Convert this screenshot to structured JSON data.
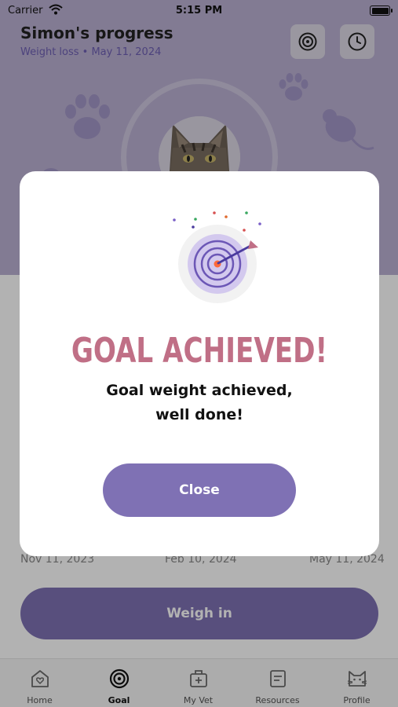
{
  "status": {
    "carrier": "Carrier",
    "time": "5:15 PM"
  },
  "header": {
    "title": "Simon's progress",
    "subtitle": "Weight loss • May 11, 2024",
    "goal_icon": "target-icon",
    "history_icon": "clock-icon"
  },
  "chart": {
    "dates": [
      "Nov 11, 2023",
      "Feb 10, 2024",
      "May 11, 2024"
    ]
  },
  "weigh_in": {
    "label": "Weigh in"
  },
  "tabs": [
    {
      "label": "Home",
      "icon": "home-heart-icon",
      "active": false
    },
    {
      "label": "Goal",
      "icon": "target-icon",
      "active": true
    },
    {
      "label": "My Vet",
      "icon": "vet-bag-icon",
      "active": false
    },
    {
      "label": "Resources",
      "icon": "document-icon",
      "active": false
    },
    {
      "label": "Profile",
      "icon": "cat-face-icon",
      "active": false
    }
  ],
  "modal": {
    "title": "GOAL ACHIEVED!",
    "message_line1": "Goal weight achieved,",
    "message_line2": "well done!",
    "close_label": "Close",
    "illustration_icon": "target-arrow-icon"
  },
  "colors": {
    "header_bg": "#bbb1d3",
    "accent": "#7f71b4",
    "title_pink": "#c06f86",
    "subtitle": "#6e5fb3"
  }
}
